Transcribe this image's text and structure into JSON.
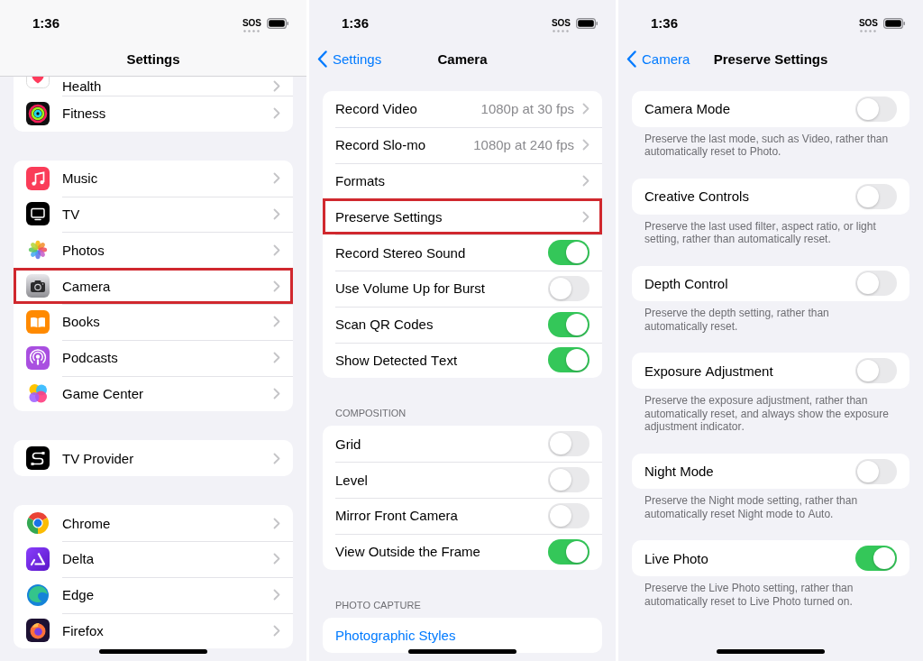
{
  "screens": [
    {
      "status_bar": {
        "time": "1:36",
        "signal_text": "SOS"
      },
      "nav_bar": {
        "title": "Settings",
        "scrolled": true
      },
      "groups": [
        {
          "rows": [
            {
              "kind": "app",
              "label": "Health",
              "highlighted": false
            },
            {
              "kind": "app",
              "label": "Fitness",
              "highlighted": false
            }
          ]
        },
        {
          "rows": [
            {
              "kind": "app",
              "label": "Music",
              "highlighted": false
            },
            {
              "kind": "app",
              "label": "TV",
              "highlighted": false
            },
            {
              "kind": "app",
              "label": "Photos",
              "highlighted": false
            },
            {
              "kind": "app",
              "label": "Camera",
              "highlighted": true
            },
            {
              "kind": "app",
              "label": "Books",
              "highlighted": false
            },
            {
              "kind": "app",
              "label": "Podcasts",
              "highlighted": false
            },
            {
              "kind": "app",
              "label": "Game Center",
              "highlighted": false
            }
          ]
        },
        {
          "rows": [
            {
              "kind": "app",
              "label": "TV Provider",
              "highlighted": false
            }
          ]
        },
        {
          "rows": [
            {
              "kind": "app",
              "label": "Chrome",
              "highlighted": false
            },
            {
              "kind": "app",
              "label": "Delta",
              "highlighted": false
            },
            {
              "kind": "app",
              "label": "Edge",
              "highlighted": false
            },
            {
              "kind": "app",
              "label": "Firefox",
              "highlighted": false
            }
          ]
        }
      ]
    },
    {
      "status_bar": {
        "time": "1:36",
        "signal_text": "SOS"
      },
      "nav_bar": {
        "back_label": "Settings",
        "title": "Camera",
        "scrolled": false
      },
      "groups": [
        {
          "rows": [
            {
              "kind": "link",
              "label": "Record Video",
              "value": "1080p at 30 fps",
              "highlighted": false
            },
            {
              "kind": "link",
              "label": "Record Slo-mo",
              "value": "1080p at 240 fps",
              "highlighted": false
            },
            {
              "kind": "link",
              "label": "Formats",
              "highlighted": false
            },
            {
              "kind": "link",
              "label": "Preserve Settings",
              "highlighted": true
            },
            {
              "kind": "toggle",
              "label": "Record Stereo Sound",
              "on": true,
              "highlighted": false
            },
            {
              "kind": "toggle",
              "label": "Use Volume Up for Burst",
              "on": false,
              "highlighted": false
            },
            {
              "kind": "toggle",
              "label": "Scan QR Codes",
              "on": true,
              "highlighted": false
            },
            {
              "kind": "toggle",
              "label": "Show Detected Text",
              "on": true,
              "highlighted": false
            }
          ]
        },
        {
          "header": "COMPOSITION",
          "rows": [
            {
              "kind": "toggle",
              "label": "Grid",
              "on": false,
              "highlighted": false
            },
            {
              "kind": "toggle",
              "label": "Level",
              "on": false,
              "highlighted": false
            },
            {
              "kind": "toggle",
              "label": "Mirror Front Camera",
              "on": false,
              "highlighted": false
            },
            {
              "kind": "toggle",
              "label": "View Outside the Frame",
              "on": true,
              "highlighted": false
            }
          ]
        },
        {
          "header": "PHOTO CAPTURE",
          "rows": [
            {
              "kind": "action",
              "label": "Photographic Styles",
              "highlighted": false
            }
          ]
        }
      ]
    },
    {
      "status_bar": {
        "time": "1:36",
        "signal_text": "SOS"
      },
      "nav_bar": {
        "back_label": "Camera",
        "title": "Preserve Settings",
        "scrolled": false
      },
      "groups": [
        {
          "rows": [
            {
              "kind": "toggle",
              "label": "Camera Mode",
              "on": false,
              "highlighted": false
            }
          ],
          "footer": "Preserve the last mode, such as Video, rather than automatically reset to Photo."
        },
        {
          "rows": [
            {
              "kind": "toggle",
              "label": "Creative Controls",
              "on": false,
              "highlighted": false
            }
          ],
          "footer": "Preserve the last used filter, aspect ratio, or light setting, rather than automatically reset."
        },
        {
          "rows": [
            {
              "kind": "toggle",
              "label": "Depth Control",
              "on": false,
              "highlighted": false
            }
          ],
          "footer": "Preserve the depth setting, rather than automatically reset."
        },
        {
          "rows": [
            {
              "kind": "toggle",
              "label": "Exposure Adjustment",
              "on": false,
              "highlighted": false
            }
          ],
          "footer": "Preserve the exposure adjustment, rather than automatically reset, and always show the exposure adjustment indicator."
        },
        {
          "rows": [
            {
              "kind": "toggle",
              "label": "Night Mode",
              "on": false,
              "highlighted": false
            }
          ],
          "footer": "Preserve the Night mode setting, rather than automatically reset Night mode to Auto."
        },
        {
          "rows": [
            {
              "kind": "toggle",
              "label": "Live Photo",
              "on": true,
              "highlighted": false
            }
          ],
          "footer": "Preserve the Live Photo setting, rather than automatically reset to Live Photo turned on."
        }
      ]
    }
  ]
}
